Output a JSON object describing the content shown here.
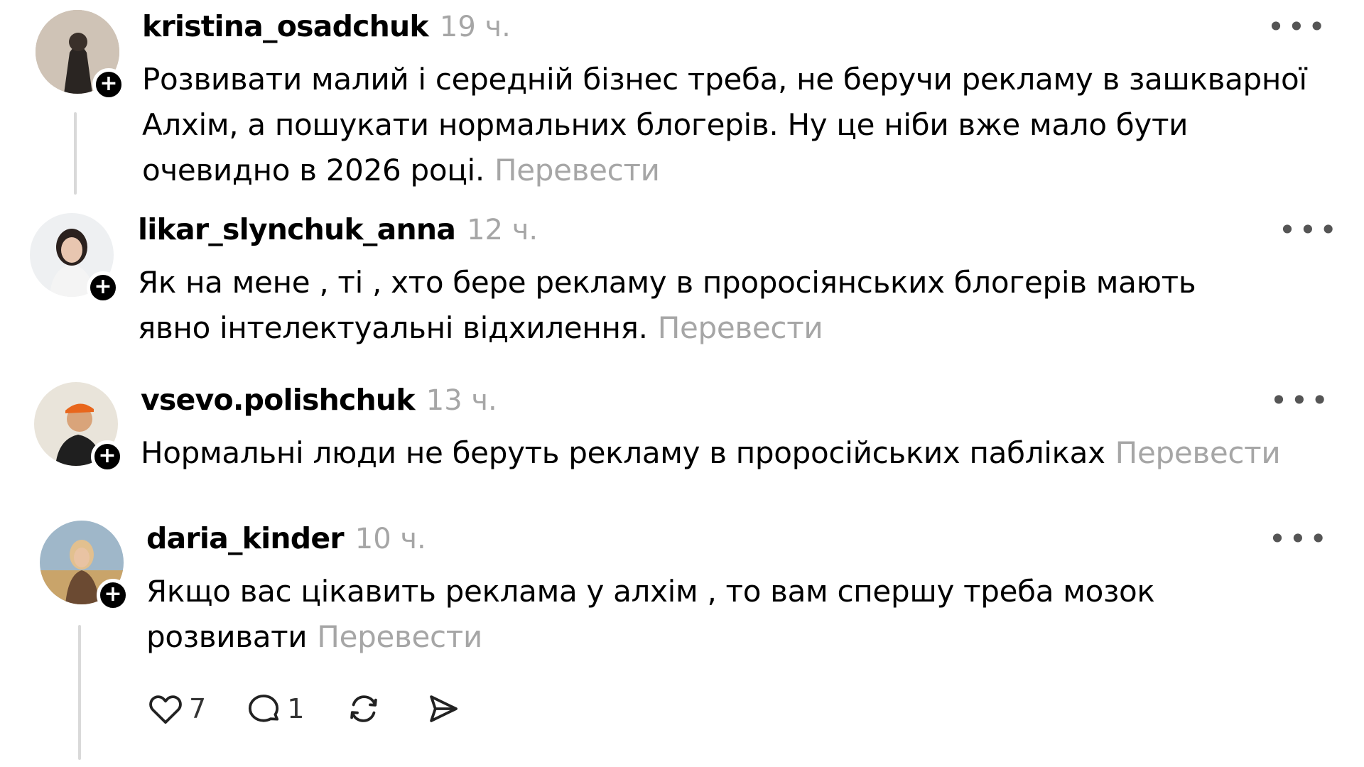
{
  "comments": [
    {
      "username": "kristina_osadchuk",
      "time": "19 ч.",
      "text": "Розвивати малий і середній бізнес треба, не беручи рекламу в зашкварної Алхім, а пошукати нормальних блогерів. Ну це ніби вже мало бути очевидно в 2026 році.",
      "translate": "Перевести",
      "more": "•••"
    },
    {
      "username": "likar_slynchuk_anna",
      "time": "12 ч.",
      "text": "Як на мене , ті , хто бере рекламу в проросіянських блогерів мають явно інтелектуальні відхилення.",
      "translate": "Перевести",
      "more": "•••"
    },
    {
      "username": "vsevo.polishchuk",
      "time": "13 ч.",
      "text": "Нормальні люди не беруть рекламу в проросійських пабліках",
      "translate": "Перевести",
      "more": "•••"
    },
    {
      "username": "daria_kinder",
      "time": "10 ч.",
      "text": "Якщо вас цікавить реклама у алхім , то вам спершу треба мозок розвивати",
      "translate": "Перевести",
      "more": "•••",
      "actions": {
        "likes": "7",
        "replies": "1"
      }
    }
  ],
  "icons": {
    "follow": "+",
    "like": "heart-icon",
    "reply": "comment-icon",
    "repost": "repost-icon",
    "share": "share-icon"
  },
  "colors": {
    "text": "#000000",
    "muted": "#a6a6a6",
    "thread_line": "#d9d9d9"
  }
}
